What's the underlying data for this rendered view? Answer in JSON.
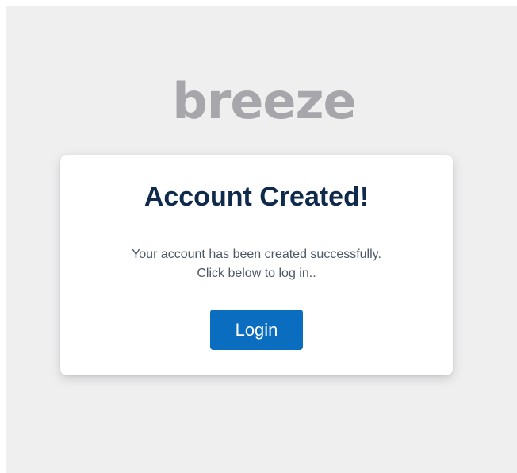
{
  "brand": {
    "logo_text": "breeze",
    "logo_color": "#a6a6ab"
  },
  "card": {
    "title": "Account Created!",
    "message_line1": "Your account has been created successfully.",
    "message_line2": "Click below to log in..",
    "login_label": "Login"
  },
  "colors": {
    "page_background": "#efeff0",
    "title": "#102a4c",
    "text": "#4d5866",
    "button": "#0b6dbf"
  }
}
